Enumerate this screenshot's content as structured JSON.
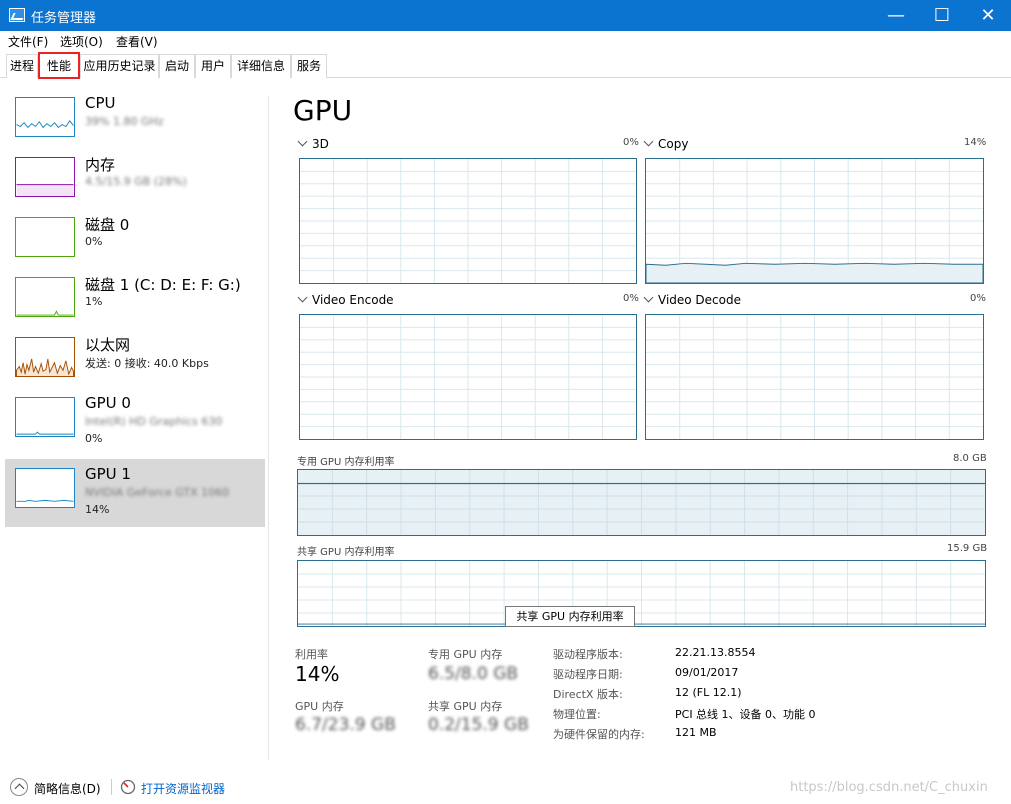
{
  "window": {
    "title": "任务管理器",
    "minimize": "—",
    "maximize": "☐",
    "close": "✕"
  },
  "menu": [
    "文件(F)",
    "选项(O)",
    "查看(V)"
  ],
  "tabs": [
    "进程",
    "性能",
    "应用历史记录",
    "启动",
    "用户",
    "详细信息",
    "服务"
  ],
  "active_tab": "性能",
  "sidebar": [
    {
      "name": "CPU",
      "sub": "39% 1.80 GHz",
      "sub_blurred": true,
      "color": "#1b86c3"
    },
    {
      "name": "内存",
      "sub": "4.5/15.9 GB (28%)",
      "sub_blurred": true,
      "color": "#8b12ae"
    },
    {
      "name": "磁盘 0",
      "sub": "0%",
      "color": "#4da60c"
    },
    {
      "name": "磁盘 1 (C: D: E: F: G:)",
      "sub": "1%",
      "color": "#4da60c"
    },
    {
      "name": "以太网",
      "sub": "发送: 0 接收: 40.0 Kbps",
      "color": "#a74f01"
    },
    {
      "name": "GPU 0",
      "sub": "Intel(R) HD Graphics 630",
      "sub_blurred": true,
      "sub2": "0%",
      "color": "#1b86c3"
    },
    {
      "name": "GPU 1",
      "sub": "NVIDIA GeForce GTX 1060",
      "sub_blurred": true,
      "sub2": "14%",
      "color": "#1b86c3",
      "selected": true
    }
  ],
  "main": {
    "title": "GPU",
    "engines": [
      {
        "name": "3D",
        "pct": "0%"
      },
      {
        "name": "Copy",
        "pct": "14%"
      },
      {
        "name": "Video Encode",
        "pct": "0%"
      },
      {
        "name": "Video Decode",
        "pct": "0%"
      }
    ],
    "dedicated_label": "专用 GPU 内存利用率",
    "dedicated_max": "8.0 GB",
    "shared_label": "共享 GPU 内存利用率",
    "shared_max": "15.9 GB",
    "tooltip": "共享 GPU 内存利用率",
    "accent": "#2a6d8f"
  },
  "stats": {
    "util_label": "利用率",
    "util_value": "14%",
    "ded_label": "专用 GPU 内存",
    "ded_value": "6.5/8.0 GB",
    "mem_label": "GPU 内存",
    "mem_value": "6.7/23.9 GB",
    "shared_label": "共享 GPU 内存",
    "shared_value": "0.2/15.9 GB"
  },
  "details": [
    {
      "k": "驱动程序版本:",
      "v": "22.21.13.8554"
    },
    {
      "k": "驱动程序日期:",
      "v": "09/01/2017"
    },
    {
      "k": "DirectX 版本:",
      "v": "12 (FL 12.1)"
    },
    {
      "k": "物理位置:",
      "v": "PCI 总线 1、设备 0、功能 0"
    },
    {
      "k": "为硬件保留的内存:",
      "v": "121 MB"
    }
  ],
  "footer": {
    "summary": "简略信息(D)",
    "monitor": "打开资源监视器"
  },
  "watermark": "https://blog.csdn.net/C_chuxin"
}
